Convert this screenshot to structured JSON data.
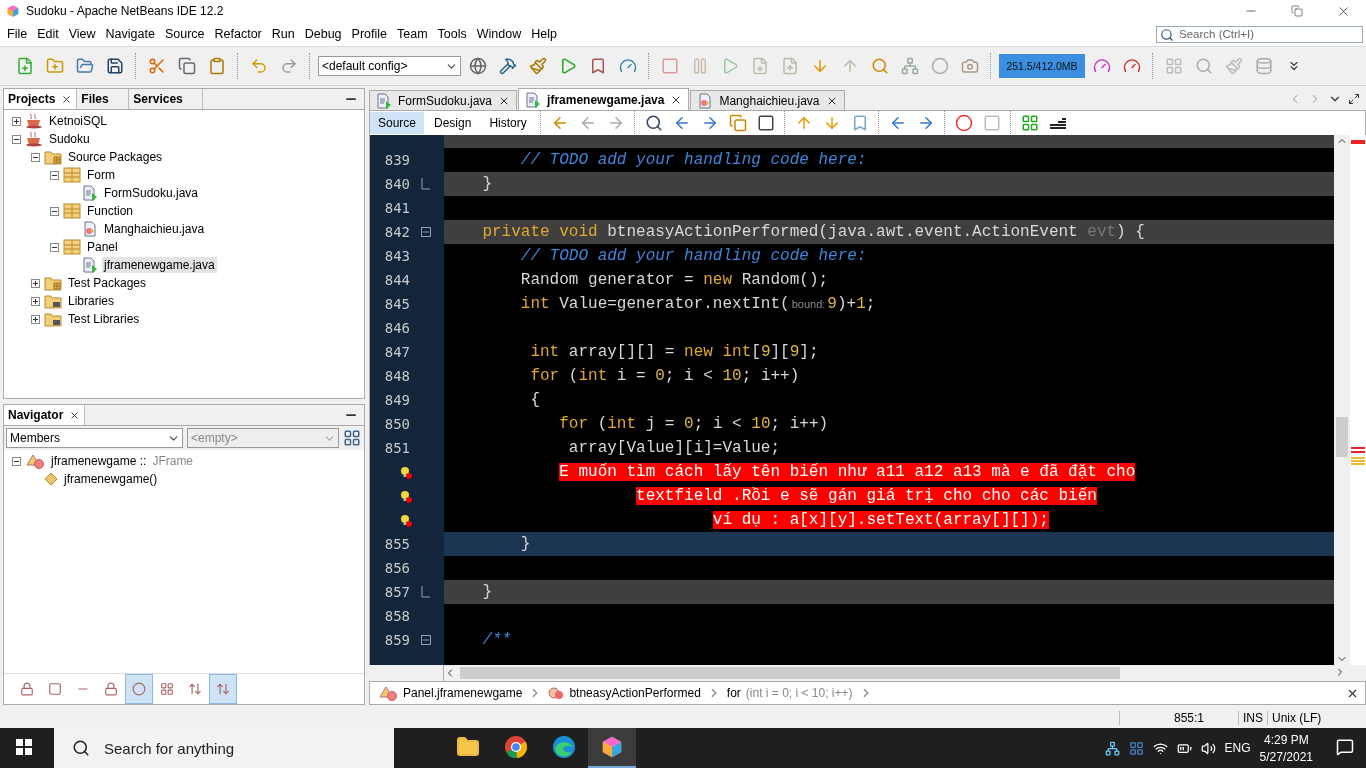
{
  "window": {
    "title": "Sudoku - Apache NetBeans IDE 12.2"
  },
  "menu": [
    "File",
    "Edit",
    "View",
    "Navigate",
    "Source",
    "Refactor",
    "Run",
    "Debug",
    "Profile",
    "Team",
    "Tools",
    "Window",
    "Help"
  ],
  "search": {
    "placeholder": "Search (Ctrl+I)"
  },
  "toolbar": {
    "config": "<default config>",
    "memory": "251.5/412.0MB"
  },
  "projects_panel": {
    "tabs": [
      {
        "label": "Projects",
        "selected": true
      },
      {
        "label": "Files",
        "selected": false
      },
      {
        "label": "Services",
        "selected": false
      }
    ],
    "tree": [
      {
        "label": "KetnoiSQL",
        "kind": "project",
        "expanded": false,
        "selected": false
      },
      {
        "label": "Sudoku",
        "kind": "project",
        "expanded": true,
        "selected": false,
        "children": [
          {
            "label": "Source Packages",
            "kind": "source-folder",
            "expanded": true,
            "selected": false,
            "children": [
              {
                "label": "Form",
                "kind": "package",
                "expanded": true,
                "selected": false,
                "children": [
                  {
                    "label": "FormSudoku.java",
                    "kind": "form-file",
                    "selected": false
                  }
                ]
              },
              {
                "label": "Function",
                "kind": "package",
                "expanded": true,
                "selected": false,
                "children": [
                  {
                    "label": "Manghaichieu.java",
                    "kind": "class-file",
                    "selected": false
                  }
                ]
              },
              {
                "label": "Panel",
                "kind": "package",
                "expanded": true,
                "selected": false,
                "children": [
                  {
                    "label": "jframenewgame.java",
                    "kind": "form-file",
                    "selected": true
                  }
                ]
              }
            ]
          },
          {
            "label": "Test Packages",
            "kind": "source-folder",
            "expanded": false,
            "selected": false
          },
          {
            "label": "Libraries",
            "kind": "library-folder",
            "expanded": false,
            "selected": false
          },
          {
            "label": "Test Libraries",
            "kind": "library-folder",
            "expanded": false,
            "selected": false
          }
        ]
      }
    ]
  },
  "navigator": {
    "tab": "Navigator",
    "members": "Members",
    "filter": "<empty>",
    "tree": [
      {
        "label": "jframenewgame ::",
        "type": "JFrame",
        "kind": "class",
        "expanded": true,
        "children": [
          {
            "label": "jframenewgame()",
            "kind": "constructor"
          }
        ]
      }
    ],
    "tools": [
      {
        "selected": false
      },
      {
        "selected": false
      },
      {
        "selected": false
      },
      {
        "selected": false
      },
      {
        "selected": true
      },
      {
        "selected": false
      },
      {
        "selected": false
      },
      {
        "selected": true
      }
    ]
  },
  "editor": {
    "tabs": [
      {
        "label": "FormSudoku.java",
        "kind": "form-file",
        "selected": false
      },
      {
        "label": "jframenewgame.java",
        "kind": "form-file",
        "selected": true
      },
      {
        "label": "Manghaichieu.java",
        "kind": "class-file",
        "selected": false
      }
    ],
    "views": [
      {
        "label": "Source",
        "selected": true
      },
      {
        "label": "Design",
        "selected": false
      },
      {
        "label": "History",
        "selected": false
      }
    ],
    "lines": [
      {
        "kind": "code",
        "highlighted": true,
        "selected": false
      },
      {
        "number": "839",
        "kind": "code",
        "highlighted": false,
        "selected": false,
        "tokens": [
          {
            "kind": "comment",
            "text": "        // TODO add your handling code here:"
          }
        ]
      },
      {
        "number": "840",
        "kind": "fold-end",
        "highlighted": true,
        "selected": false,
        "tokens": [
          {
            "kind": "plain",
            "text": "    }"
          }
        ]
      },
      {
        "number": "841",
        "kind": "code",
        "highlighted": false,
        "selected": false
      },
      {
        "number": "842",
        "kind": "fold-start",
        "highlighted": true,
        "selected": false,
        "tokens": [
          {
            "kind": "keyword",
            "text": "    private void"
          },
          {
            "kind": "plain",
            "text": " btneasyActionPerformed(java.awt.event.ActionEvent"
          },
          {
            "kind": "param",
            "text": " evt"
          },
          {
            "kind": "plain",
            "text": ") {"
          }
        ]
      },
      {
        "number": "843",
        "kind": "code",
        "highlighted": false,
        "selected": false,
        "tokens": [
          {
            "kind": "comment",
            "text": "        // TODO add your handling code here:"
          }
        ]
      },
      {
        "number": "844",
        "kind": "code",
        "highlighted": false,
        "selected": false,
        "tokens": [
          {
            "kind": "plain",
            "text": "        Random generator = "
          },
          {
            "kind": "keyword",
            "text": "new"
          },
          {
            "kind": "plain",
            "text": " Random();"
          }
        ]
      },
      {
        "number": "845",
        "kind": "code",
        "highlighted": false,
        "selected": false,
        "tokens": [
          {
            "kind": "keyword",
            "text": "        int"
          },
          {
            "kind": "plain",
            "text": " Value=generator.nextInt("
          },
          {
            "kind": "hint",
            "text": "bound:"
          },
          {
            "kind": "number",
            "text": "9"
          },
          {
            "kind": "plain",
            "text": ")+"
          },
          {
            "kind": "number",
            "text": "1"
          },
          {
            "kind": "plain",
            "text": ";"
          }
        ]
      },
      {
        "number": "846",
        "kind": "code",
        "highlighted": false,
        "selected": false
      },
      {
        "number": "847",
        "kind": "code",
        "highlighted": false,
        "selected": false,
        "tokens": [
          {
            "kind": "keyword",
            "text": "         int"
          },
          {
            "kind": "plain",
            "text": " array[][] = "
          },
          {
            "kind": "keyword",
            "text": "new int"
          },
          {
            "kind": "plain",
            "text": "["
          },
          {
            "kind": "number",
            "text": "9"
          },
          {
            "kind": "plain",
            "text": "]["
          },
          {
            "kind": "number",
            "text": "9"
          },
          {
            "kind": "plain",
            "text": "];"
          }
        ]
      },
      {
        "number": "848",
        "kind": "code",
        "highlighted": false,
        "selected": false,
        "tokens": [
          {
            "kind": "keyword",
            "text": "         for"
          },
          {
            "kind": "plain",
            "text": " ("
          },
          {
            "kind": "keyword",
            "text": "int"
          },
          {
            "kind": "plain",
            "text": " i = "
          },
          {
            "kind": "number",
            "text": "0"
          },
          {
            "kind": "plain",
            "text": "; i < "
          },
          {
            "kind": "number",
            "text": "10"
          },
          {
            "kind": "plain",
            "text": "; i++)"
          }
        ]
      },
      {
        "number": "849",
        "kind": "code",
        "highlighted": false,
        "selected": false,
        "tokens": [
          {
            "kind": "plain",
            "text": "         {"
          }
        ]
      },
      {
        "number": "850",
        "kind": "code",
        "highlighted": false,
        "selected": false,
        "tokens": [
          {
            "kind": "keyword",
            "text": "            for"
          },
          {
            "kind": "plain",
            "text": " ("
          },
          {
            "kind": "keyword",
            "text": "int"
          },
          {
            "kind": "plain",
            "text": " j = "
          },
          {
            "kind": "number",
            "text": "0"
          },
          {
            "kind": "plain",
            "text": "; i < "
          },
          {
            "kind": "number",
            "text": "10"
          },
          {
            "kind": "plain",
            "text": "; i++)"
          }
        ]
      },
      {
        "number": "851",
        "kind": "code",
        "highlighted": false,
        "selected": false,
        "tokens": [
          {
            "kind": "plain",
            "text": "             array[Value][i]=Value;"
          }
        ]
      },
      {
        "kind": "error",
        "highlighted": false,
        "selected": false,
        "tokens": [
          {
            "kind": "error",
            "text": "            E muốn tìm cách lấy tên biến như a11 a12 a13 mà e đã đặt cho"
          }
        ]
      },
      {
        "kind": "error",
        "highlighted": false,
        "selected": false,
        "tokens": [
          {
            "kind": "error",
            "text": "                    textfield .Rồi e sẽ gán giá trị cho cho các biến"
          }
        ]
      },
      {
        "kind": "error",
        "highlighted": false,
        "selected": false,
        "tokens": [
          {
            "kind": "error",
            "text": "                            ví dụ : a[x][y].setText(array[][]);"
          }
        ]
      },
      {
        "number": "855",
        "kind": "code",
        "highlighted": false,
        "selected": true,
        "tokens": [
          {
            "kind": "plain",
            "text": "        }"
          }
        ]
      },
      {
        "number": "856",
        "kind": "code",
        "highlighted": false,
        "selected": false
      },
      {
        "number": "857",
        "kind": "fold-end",
        "highlighted": true,
        "selected": false,
        "tokens": [
          {
            "kind": "plain",
            "text": "    }"
          }
        ]
      },
      {
        "number": "858",
        "kind": "code",
        "highlighted": false,
        "selected": false
      },
      {
        "number": "859",
        "kind": "fold-start",
        "highlighted": false,
        "selected": false,
        "tokens": [
          {
            "kind": "comment",
            "text": "    /**"
          }
        ]
      }
    ],
    "breadcrumbs": [
      {
        "label": "Panel.jframenewgame",
        "kind": "class"
      },
      {
        "label": "btneasyActionPerformed",
        "kind": "method"
      },
      {
        "label": "for",
        "detail": "(int i = 0; i < 10; i++)",
        "kind": "statement"
      }
    ]
  },
  "status_bar": {
    "position": "855:1",
    "mode": "INS",
    "line_ending": "Unix (LF)"
  },
  "taskbar": {
    "search": "Search for anything",
    "apps": [
      {
        "selected": false
      },
      {
        "selected": false
      },
      {
        "selected": false
      },
      {
        "selected": true
      }
    ],
    "language": "ENG",
    "time": "4:29 PM",
    "date": "5/27/2021"
  }
}
